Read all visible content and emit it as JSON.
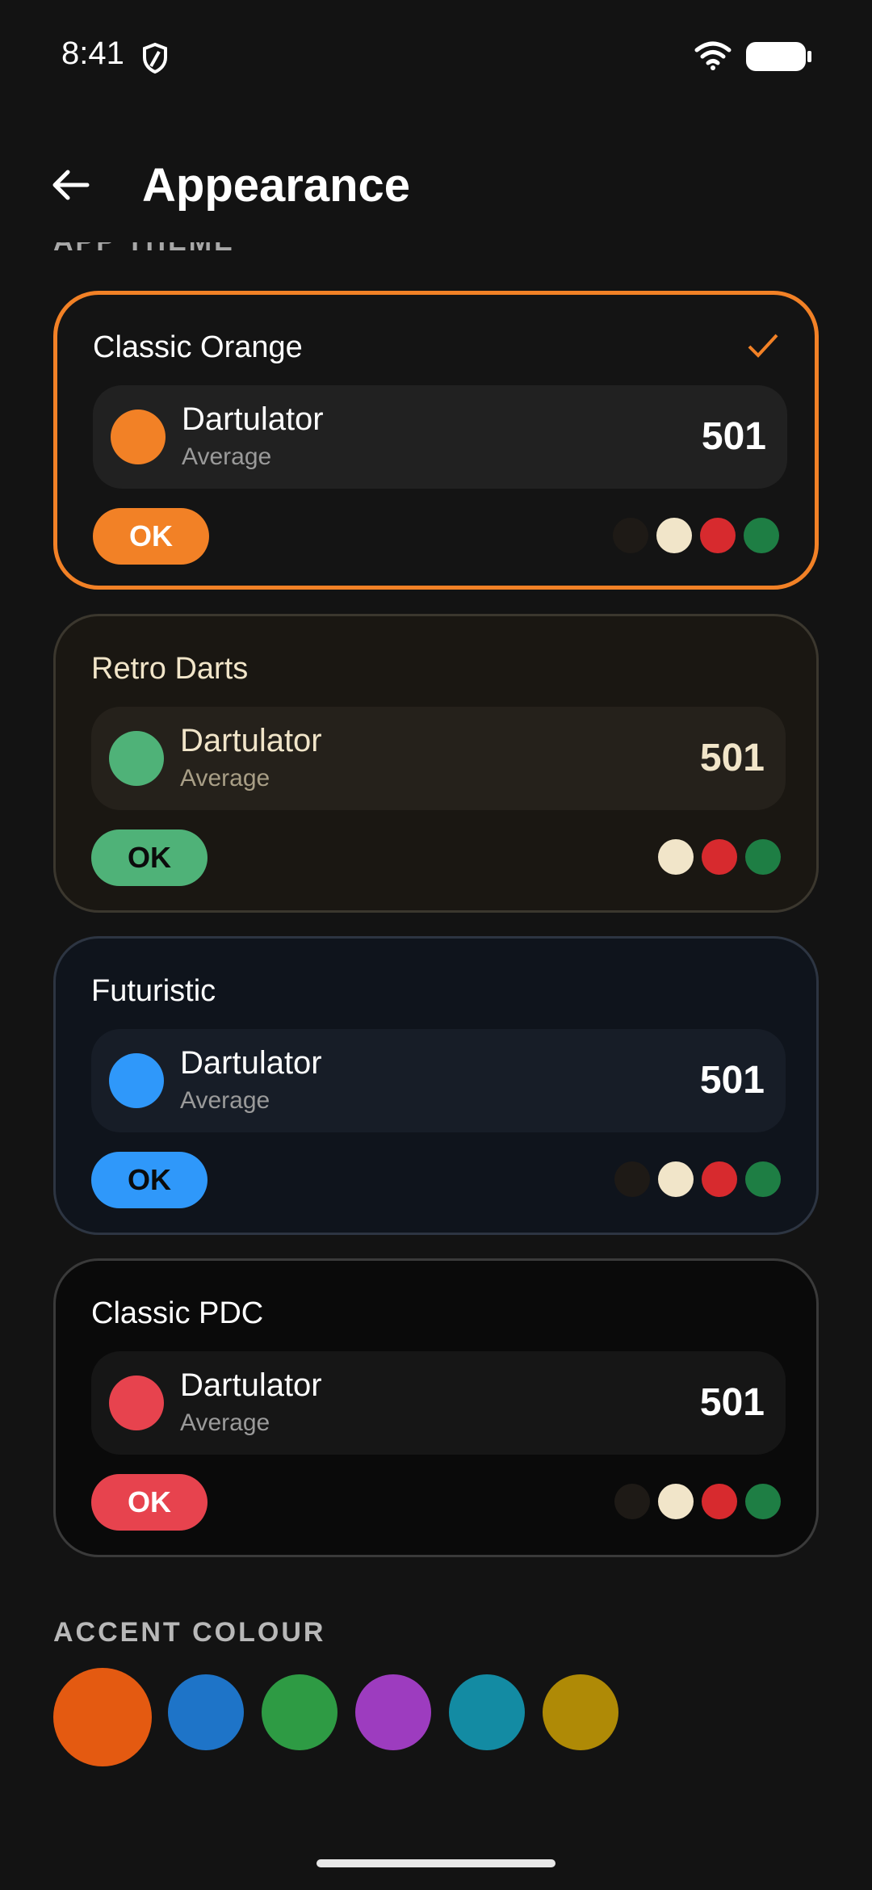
{
  "status_bar": {
    "time": "8:41"
  },
  "header": {
    "title": "Appearance"
  },
  "sections": {
    "app_theme_label": "APP THEME",
    "accent_label": "ACCENT COLOUR"
  },
  "themes": [
    {
      "name": "Classic Orange",
      "selected": true,
      "player": "Dartulator",
      "stat_label": "Average",
      "score": "501",
      "button": "OK",
      "accent": "#F28126",
      "background": "#141414",
      "border": "#F28126",
      "preview_bg": "#212121"
    },
    {
      "name": "Retro Darts",
      "selected": false,
      "player": "Dartulator",
      "stat_label": "Average",
      "score": "501",
      "button": "OK",
      "accent": "#4FB278",
      "background": "#1A1712",
      "border": "#3B372E",
      "preview_bg": "#25211B"
    },
    {
      "name": "Futuristic",
      "selected": false,
      "player": "Dartulator",
      "stat_label": "Average",
      "score": "501",
      "button": "OK",
      "accent": "#2F98FA",
      "background": "#0F141C",
      "border": "#2D3542",
      "preview_bg": "#171D27"
    },
    {
      "name": "Classic PDC",
      "selected": false,
      "player": "Dartulator",
      "stat_label": "Average",
      "score": "501",
      "button": "OK",
      "accent": "#E7434E",
      "background": "#0A0A0A",
      "border": "#3A3A3A",
      "preview_bg": "#161616"
    }
  ],
  "swatch_colors": [
    "#1E1A16",
    "#F1E5C9",
    "#D72A2E",
    "#1E7E44"
  ],
  "accent_colors": [
    {
      "color": "#E45A11",
      "selected": true
    },
    {
      "color": "#1E74C8",
      "selected": false
    },
    {
      "color": "#2E9B44",
      "selected": false
    },
    {
      "color": "#9D3CBF",
      "selected": false
    },
    {
      "color": "#138BA3",
      "selected": false
    },
    {
      "color": "#AF8A06",
      "selected": false
    }
  ]
}
